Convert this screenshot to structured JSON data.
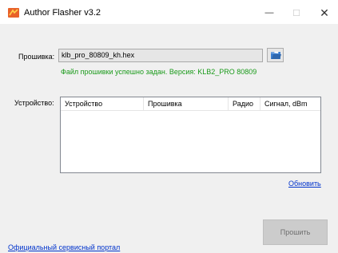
{
  "window": {
    "title": "Author Flasher v3.2",
    "minimize_glyph": "—",
    "maximize_glyph": "☐",
    "close_glyph": "✕"
  },
  "firmware": {
    "label": "Прошивка:",
    "value": "klb_pro_80809_kh.hex",
    "status": "Файл прошивки успешно задан. Версия: KLB2_PRO 80809",
    "status_color": "#1a9a1a"
  },
  "device": {
    "label": "Устройство:",
    "columns": [
      "Устройство",
      "Прошивка",
      "Радио",
      "Сигнал, dBm"
    ],
    "rows": []
  },
  "refresh_label": "Обновить",
  "flash_button_label": "Прошить",
  "portal_link_label": "Официальный сервисный портал",
  "colors": {
    "accent_link": "#0033cc",
    "app_icon": "#e8622a"
  },
  "icons": {
    "app": "author-flasher-app-icon",
    "browse": "folder-open-icon"
  }
}
